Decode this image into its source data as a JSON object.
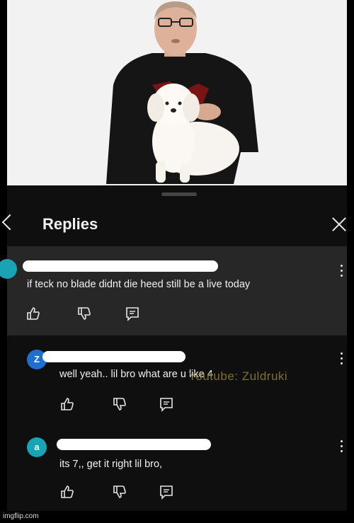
{
  "panel": {
    "title": "Replies"
  },
  "parent_comment": {
    "text": "if teck no blade didnt die heed still be a live today"
  },
  "replies": [
    {
      "avatar_letter": "Z",
      "avatar_color": "#1f6fd1",
      "text": "well yeah.. lil bro what are u like 4"
    },
    {
      "avatar_letter": "a",
      "avatar_color": "#1aa3b4",
      "text": "its 7,, get it right lil bro,"
    }
  ],
  "overlay": {
    "watermark": "Youtube: Zuldruki"
  },
  "footer": {
    "site": "imgflip.com"
  },
  "icons": [
    "back-chevron-icon",
    "close-icon",
    "thumbs-up-icon",
    "thumbs-down-icon",
    "reply-icon",
    "more-vertical-icon"
  ]
}
